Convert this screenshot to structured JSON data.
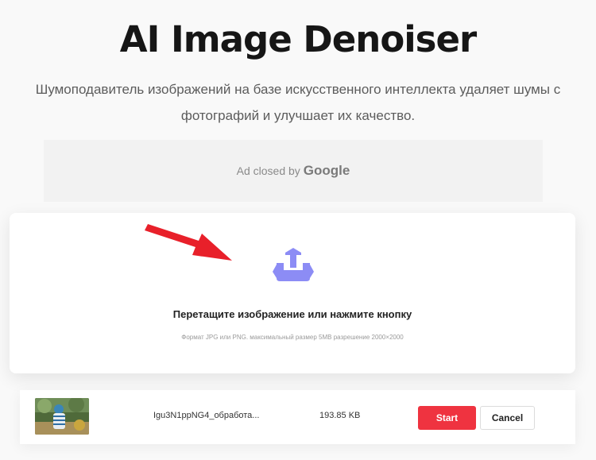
{
  "header": {
    "title": "AI Image Denoiser",
    "subtitle": "Шумоподавитель изображений на базе искусственного интеллекта удаляет шумы с фотографий и улучшает их качество."
  },
  "ad": {
    "text": "Ad closed by",
    "brand": "Google"
  },
  "dropzone": {
    "title": "Перетащите изображение или нажмите кнопку",
    "hint": "Формат JPG или PNG. максимальный размер 5MB разрешение 2000×2000",
    "icon": "upload-icon",
    "icon_color": "#8c8cf5",
    "pointer_arrow_color": "#e8202a"
  },
  "file": {
    "name": "Igu3N1ppNG4_обработа...",
    "size": "193.85 KB",
    "start_label": "Start",
    "cancel_label": "Cancel",
    "start_color": "#ef3340"
  }
}
